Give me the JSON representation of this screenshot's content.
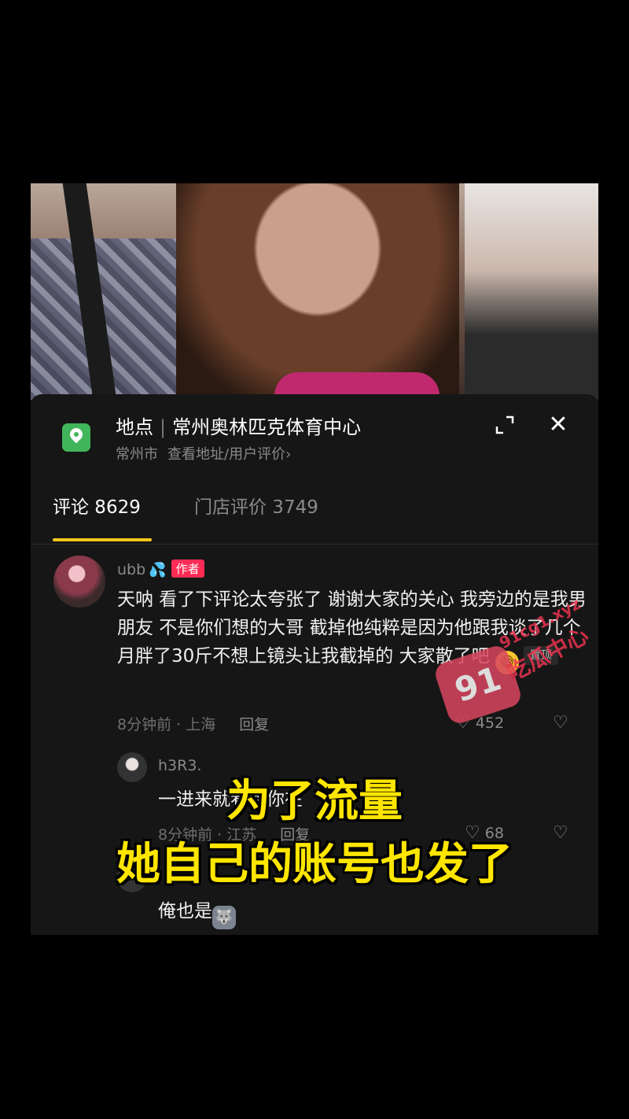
{
  "location": {
    "label": "地点",
    "name": "常州奥林匹克体育中心",
    "city": "常州市",
    "link": "查看地址/用户评价",
    "link_arrow": "›"
  },
  "tabs": [
    {
      "label": "评论 8629",
      "active": true
    },
    {
      "label": "门店评价 3749",
      "active": false
    }
  ],
  "comments": [
    {
      "user": "ubb",
      "badge": "作者",
      "text": "天呐 看了下评论太夸张了 谢谢大家的关心 我旁边的是我男朋友 不是你们想的大哥 截掉他纯粹是因为他跟我谈了几个月胖了30斤不想上镜头让我截掉的 大家散了吧",
      "pinned_label": "置顶",
      "time_location": "8分钟前 · 上海",
      "reply_label": "回复",
      "likes": "452"
    },
    {
      "user": "h3R3.",
      "text": "一进来就看到你在",
      "time_location": "8分钟前 · 江苏",
      "reply_label": "回复",
      "likes": "68"
    },
    {
      "text": "俺也是"
    }
  ],
  "caption": {
    "line1": "为了流量",
    "line2": "她自己的账号也发了"
  },
  "watermark": {
    "badge": "91",
    "url": "91cg1.xyz",
    "name": "吃瓜中心"
  },
  "colors": {
    "accent_tab": "#f5c518",
    "author_badge": "#fe2c55",
    "location_icon": "#41b55a",
    "caption": "#ffe600"
  }
}
